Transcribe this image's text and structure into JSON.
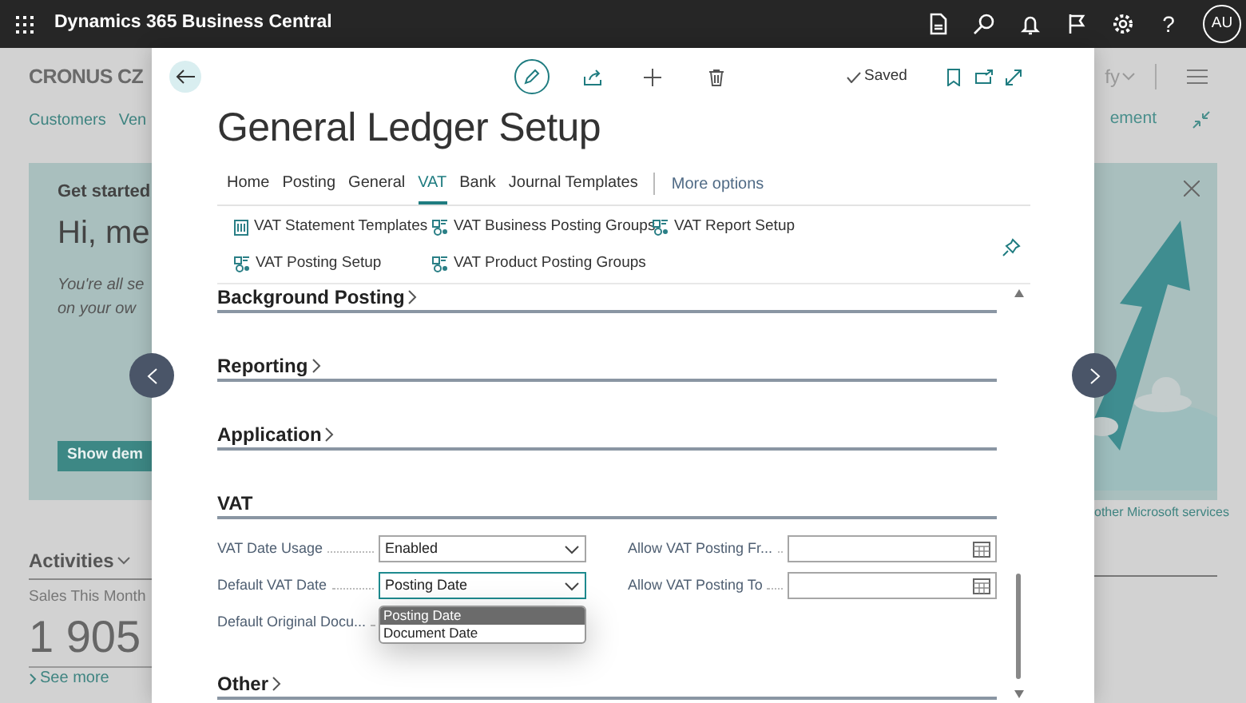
{
  "top_bar": {
    "product": "Dynamics 365 Business Central",
    "help": "?",
    "avatar": "AU"
  },
  "background_page": {
    "company": "CRONUS CZ",
    "menu_text": "fy",
    "nav_left": [
      "Customers",
      "Ven"
    ],
    "nav_right": "ement",
    "get_started": {
      "heading": "Get started",
      "greeting": "Hi, me",
      "lines": [
        "You're all se",
        "on your ow"
      ],
      "button": "Show dem"
    },
    "services_link": "other Microsoft services",
    "activities": {
      "title": "Activities",
      "metric_label": "Sales This Month",
      "metric_value": "1 905",
      "see_more": "See more"
    }
  },
  "dialog": {
    "title": "General Ledger Setup",
    "saved": "Saved",
    "tabs": [
      {
        "label": "Home",
        "selected": false
      },
      {
        "label": "Posting",
        "selected": false
      },
      {
        "label": "General",
        "selected": false
      },
      {
        "label": "VAT",
        "selected": true
      },
      {
        "label": "Bank",
        "selected": false
      },
      {
        "label": "Journal Templates",
        "selected": false
      }
    ],
    "more_options": "More options",
    "actions": [
      {
        "label": "VAT Statement Templates",
        "kind": "report"
      },
      {
        "label": "VAT Business Posting Groups",
        "kind": "setup"
      },
      {
        "label": "VAT Report Setup",
        "kind": "setup"
      },
      {
        "label": "VAT Posting Setup",
        "kind": "setup"
      },
      {
        "label": "VAT Product Posting Groups",
        "kind": "setup"
      }
    ],
    "sections": [
      {
        "title": "Background Posting",
        "expanded": false
      },
      {
        "title": "Reporting",
        "expanded": false
      },
      {
        "title": "Application",
        "expanded": false
      },
      {
        "title": "VAT",
        "expanded": true,
        "fields": [
          {
            "label": "VAT Date Usage",
            "kind": "select",
            "value": "Enabled",
            "focused": false
          },
          {
            "label": "Allow VAT Posting Fr...",
            "kind": "date",
            "focused": false
          },
          {
            "label": "Default VAT Date",
            "kind": "select",
            "value": "Posting Date",
            "focused": true
          },
          {
            "label": "Allow VAT Posting To",
            "kind": "date",
            "focused": false
          },
          {
            "label": "Default Original Docu...",
            "kind": "covered"
          }
        ],
        "dropdown": {
          "options": [
            {
              "label": "Posting Date",
              "selected": true
            },
            {
              "label": "Document Date",
              "selected": false
            }
          ]
        }
      },
      {
        "title": "Other",
        "expanded": false
      }
    ]
  }
}
